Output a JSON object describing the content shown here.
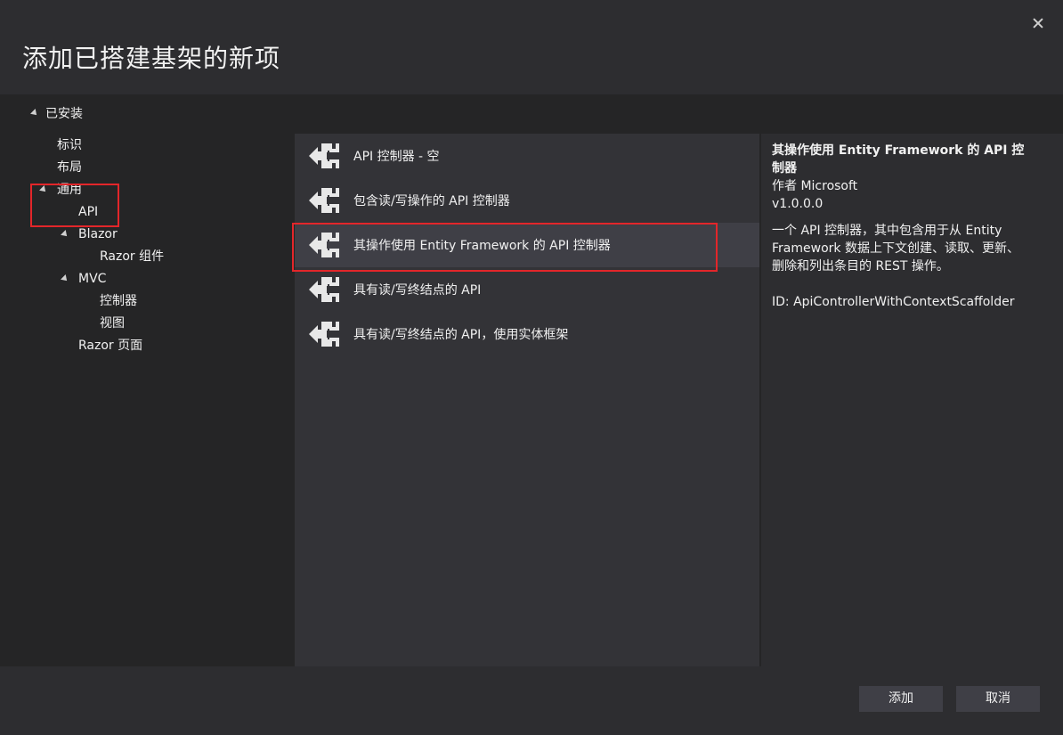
{
  "dialog": {
    "title": "添加已搭建基架的新项",
    "close_label": "×"
  },
  "tree": {
    "root_label": "已安装",
    "items": [
      {
        "label": "标识"
      },
      {
        "label": "布局"
      },
      {
        "label": "通用"
      },
      {
        "label": "API"
      },
      {
        "label": "Blazor"
      },
      {
        "label": "Razor 组件"
      },
      {
        "label": "MVC"
      },
      {
        "label": "控制器"
      },
      {
        "label": "视图"
      },
      {
        "label": "Razor 页面"
      }
    ]
  },
  "templates": {
    "items": [
      {
        "label": "API 控制器 - 空",
        "icon": "scaffold-icon"
      },
      {
        "label": "包含读/写操作的 API 控制器",
        "icon": "scaffold-icon"
      },
      {
        "label": "其操作使用 Entity Framework 的 API 控制器",
        "icon": "scaffold-icon",
        "selected": true
      },
      {
        "label": "具有读/写终结点的 API",
        "icon": "scaffold-icon"
      },
      {
        "label": "具有读/写终结点的 API，使用实体框架",
        "icon": "scaffold-icon"
      }
    ]
  },
  "details": {
    "title": "其操作使用 Entity Framework 的 API 控制器",
    "author": "作者 Microsoft",
    "version": "v1.0.0.0",
    "description": "一个 API 控制器，其中包含用于从 Entity Framework 数据上下文创建、读取、更新、删除和列出条目的 REST 操作。",
    "id_line": "ID: ApiControllerWithContextScaffolder"
  },
  "footer": {
    "add_label": "添加",
    "cancel_label": "取消"
  },
  "colors": {
    "background": "#2d2d30",
    "panel": "#333337",
    "selected": "#3f3f46",
    "highlight_border": "#e3262a",
    "text": "#f1f1f1"
  }
}
